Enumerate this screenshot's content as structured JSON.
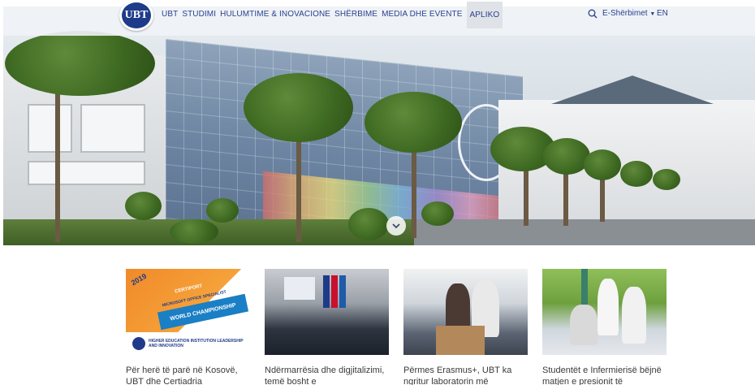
{
  "header": {
    "logo_text": "UBT",
    "nav": [
      {
        "label": "UBT"
      },
      {
        "label": "STUDIMI"
      },
      {
        "label": "HULUMTIME & INOVACIONE"
      },
      {
        "label": "SHËRBIME"
      },
      {
        "label": "MEDIA DHE EVENTE"
      },
      {
        "label": "APLIKO"
      }
    ],
    "eservices_label": "E-Shërbimet",
    "language": "EN"
  },
  "hero": {
    "icon": "chevron-down-icon"
  },
  "news": [
    {
      "title": "Për herë të parë në Kosovë, UBT dhe Certiadria",
      "thumb": {
        "year": "2019",
        "certiport": "CERTIPORT",
        "mos": "MICROSOFT OFFICE SPECIALIST",
        "banner": "WORLD CHAMPIONSHIP",
        "footer": "HIGHER EDUCATION INSTITUTION LEADERSHIP AND INNOVATION"
      }
    },
    {
      "title": "Ndërmarrësia dhe digjitalizimi, temë bosht e"
    },
    {
      "title": "Përmes Erasmus+, UBT ka ngritur laboratorin më"
    },
    {
      "title": "Studentët e Infermierisë bëjnë matjen e presionit të"
    }
  ],
  "colors": {
    "brand": "#1e3b8a",
    "nav_text": "#2a3f8f"
  }
}
